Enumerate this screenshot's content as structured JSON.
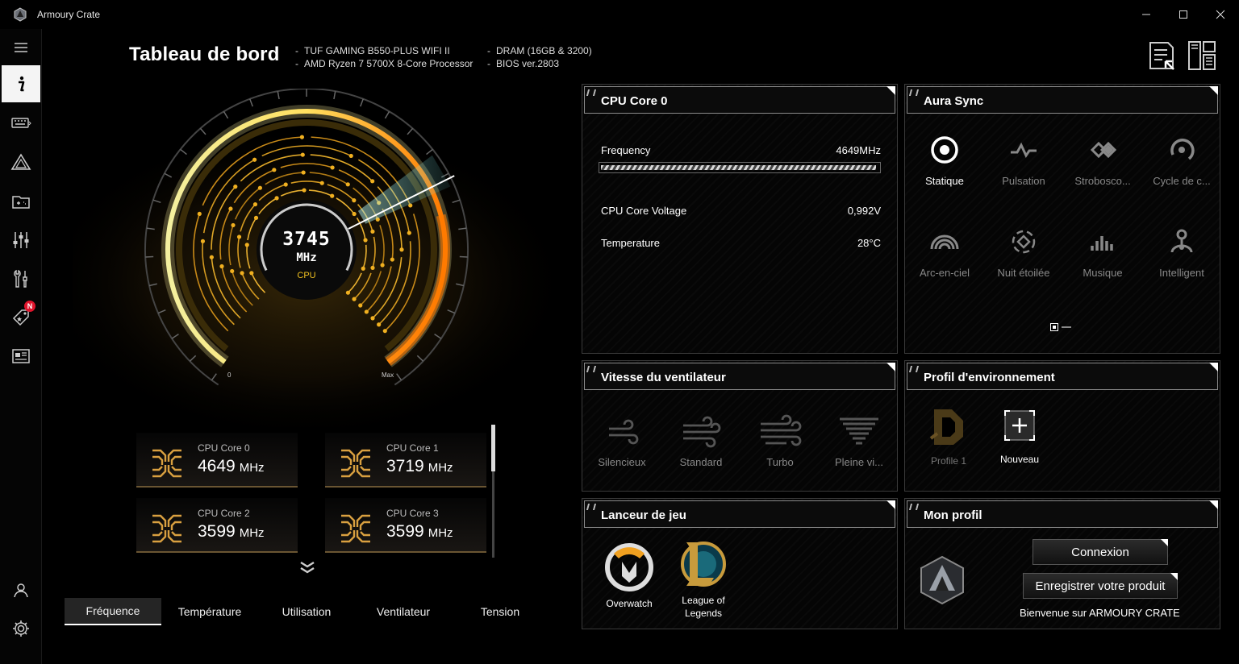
{
  "app": {
    "title": "Armoury Crate"
  },
  "window": {
    "minimize_icon": "minimize-icon",
    "maximize_icon": "maximize-icon",
    "close_icon": "close-icon"
  },
  "header": {
    "title": "Tableau de bord",
    "info_left": [
      "TUF GAMING B550-PLUS WIFI II",
      "AMD Ryzen 7 5700X 8-Core Processor"
    ],
    "info_right": [
      "DRAM (16GB & 3200)",
      "BIOS ver.2803"
    ]
  },
  "sidebar": {
    "badge": "N",
    "items": [
      "menu-icon",
      "info-icon",
      "keyboard-icon",
      "aura-icon",
      "game-library-icon",
      "tuning-icon",
      "tools-icon",
      "deals-icon",
      "news-icon",
      "user-icon",
      "settings-icon"
    ]
  },
  "gauge": {
    "value": "3745",
    "unit": "MHz",
    "label": "CPU",
    "min_label": "0",
    "max_label": "Max",
    "level": 0.72
  },
  "cores": [
    {
      "name": "CPU Core 0",
      "value": "4649",
      "unit": "MHz"
    },
    {
      "name": "CPU Core 1",
      "value": "3719",
      "unit": "MHz"
    },
    {
      "name": "CPU Core 2",
      "value": "3599",
      "unit": "MHz"
    },
    {
      "name": "CPU Core 3",
      "value": "3599",
      "unit": "MHz"
    }
  ],
  "tabs": [
    "Fréquence",
    "Température",
    "Utilisation",
    "Ventilateur",
    "Tension"
  ],
  "cpu_panel": {
    "title": "CPU Core 0",
    "frequency_label": "Frequency",
    "frequency_value": "4649MHz",
    "frequency_fill": 0.99,
    "voltage_label": "CPU Core Voltage",
    "voltage_value": "0,992V",
    "temp_label": "Temperature",
    "temp_value": "28°C"
  },
  "aura": {
    "title": "Aura Sync",
    "modes": [
      "Statique",
      "Pulsation",
      "Strobosco...",
      "Cycle de c...",
      "Arc-en-ciel",
      "Nuit étoilée",
      "Musique",
      "Intelligent"
    ]
  },
  "fan": {
    "title": "Vitesse du ventilateur",
    "modes": [
      "Silencieux",
      "Standard",
      "Turbo",
      "Pleine vi..."
    ]
  },
  "env": {
    "title": "Profil d'environnement",
    "profile1": "Profile 1",
    "new": "Nouveau"
  },
  "games": {
    "title": "Lanceur de jeu",
    "items": [
      "Overwatch",
      "League of",
      "Legends"
    ]
  },
  "profile": {
    "title": "Mon profil",
    "login": "Connexion",
    "register": "Enregistrer votre produit",
    "welcome": "Bienvenue sur ARMOURY CRATE"
  },
  "colors": {
    "accent_gold": "#f0c020",
    "accent_orange": "#ff8a00",
    "panel_border": "#3a3a3a"
  }
}
